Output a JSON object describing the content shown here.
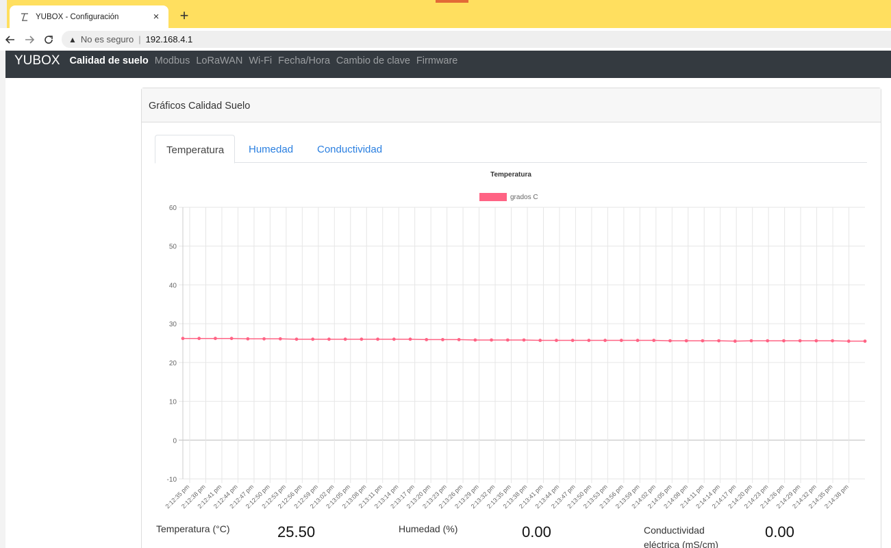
{
  "browser": {
    "tab_title": "YUBOX - Configuración",
    "tab_close": "×",
    "new_tab": "+",
    "security_text": "No es seguro",
    "url": "192.168.4.1"
  },
  "navbar": {
    "brand": "YUBOX",
    "items": [
      {
        "label": "Calidad de suelo",
        "active": true
      },
      {
        "label": "Modbus",
        "active": false
      },
      {
        "label": "LoRaWAN",
        "active": false
      },
      {
        "label": "Wi-Fi",
        "active": false
      },
      {
        "label": "Fecha/Hora",
        "active": false
      },
      {
        "label": "Cambio de clave",
        "active": false
      },
      {
        "label": "Firmware",
        "active": false
      }
    ]
  },
  "card": {
    "title": "Gráficos Calidad Suelo",
    "tabs": [
      {
        "label": "Temperatura",
        "active": true
      },
      {
        "label": "Humedad",
        "active": false
      },
      {
        "label": "Conductividad",
        "active": false
      }
    ]
  },
  "chart_data": {
    "type": "line",
    "title": "Temperatura",
    "series": [
      {
        "name": "grados C",
        "color": "#ff6384",
        "values": [
          26.2,
          26.2,
          26.2,
          26.2,
          26.1,
          26.1,
          26.1,
          26.0,
          26.0,
          26.0,
          26.0,
          26.0,
          26.0,
          26.0,
          26.0,
          25.9,
          25.9,
          25.9,
          25.8,
          25.8,
          25.8,
          25.8,
          25.7,
          25.7,
          25.7,
          25.7,
          25.7,
          25.7,
          25.7,
          25.7,
          25.6,
          25.6,
          25.6,
          25.6,
          25.5,
          25.6,
          25.6,
          25.6,
          25.6,
          25.6,
          25.6,
          25.5,
          25.5
        ]
      }
    ],
    "x": [
      "2:12:35 pm",
      "2:12:38 pm",
      "2:12:41 pm",
      "2:12:44 pm",
      "2:12:47 pm",
      "2:12:50 pm",
      "2:12:53 pm",
      "2:12:56 pm",
      "2:12:59 pm",
      "2:13:02 pm",
      "2:13:05 pm",
      "2:13:08 pm",
      "2:13:11 pm",
      "2:13:14 pm",
      "2:13:17 pm",
      "2:13:20 pm",
      "2:13:23 pm",
      "2:13:26 pm",
      "2:13:29 pm",
      "2:13:32 pm",
      "2:13:35 pm",
      "2:13:38 pm",
      "2:13:41 pm",
      "2:13:44 pm",
      "2:13:47 pm",
      "2:13:50 pm",
      "2:13:53 pm",
      "2:13:56 pm",
      "2:13:59 pm",
      "2:14:02 pm",
      "2:14:05 pm",
      "2:14:08 pm",
      "2:14:11 pm",
      "2:14:14 pm",
      "2:14:17 pm",
      "2:14:20 pm",
      "2:14:23 pm",
      "2:14:26 pm",
      "2:14:29 pm",
      "2:14:32 pm",
      "2:14:35 pm",
      "2:14:38 pm"
    ],
    "ylim": [
      -10,
      60
    ],
    "yticks": [
      -10,
      0,
      10,
      20,
      30,
      40,
      50,
      60
    ],
    "legend_position": "top",
    "grid": true
  },
  "readouts": [
    {
      "label": "Temperatura (°C)",
      "value": "25.50"
    },
    {
      "label": "Humedad (%)",
      "value": "0.00"
    },
    {
      "label": "Conductividad eléctrica (mS/cm)",
      "value": "0.00"
    }
  ]
}
